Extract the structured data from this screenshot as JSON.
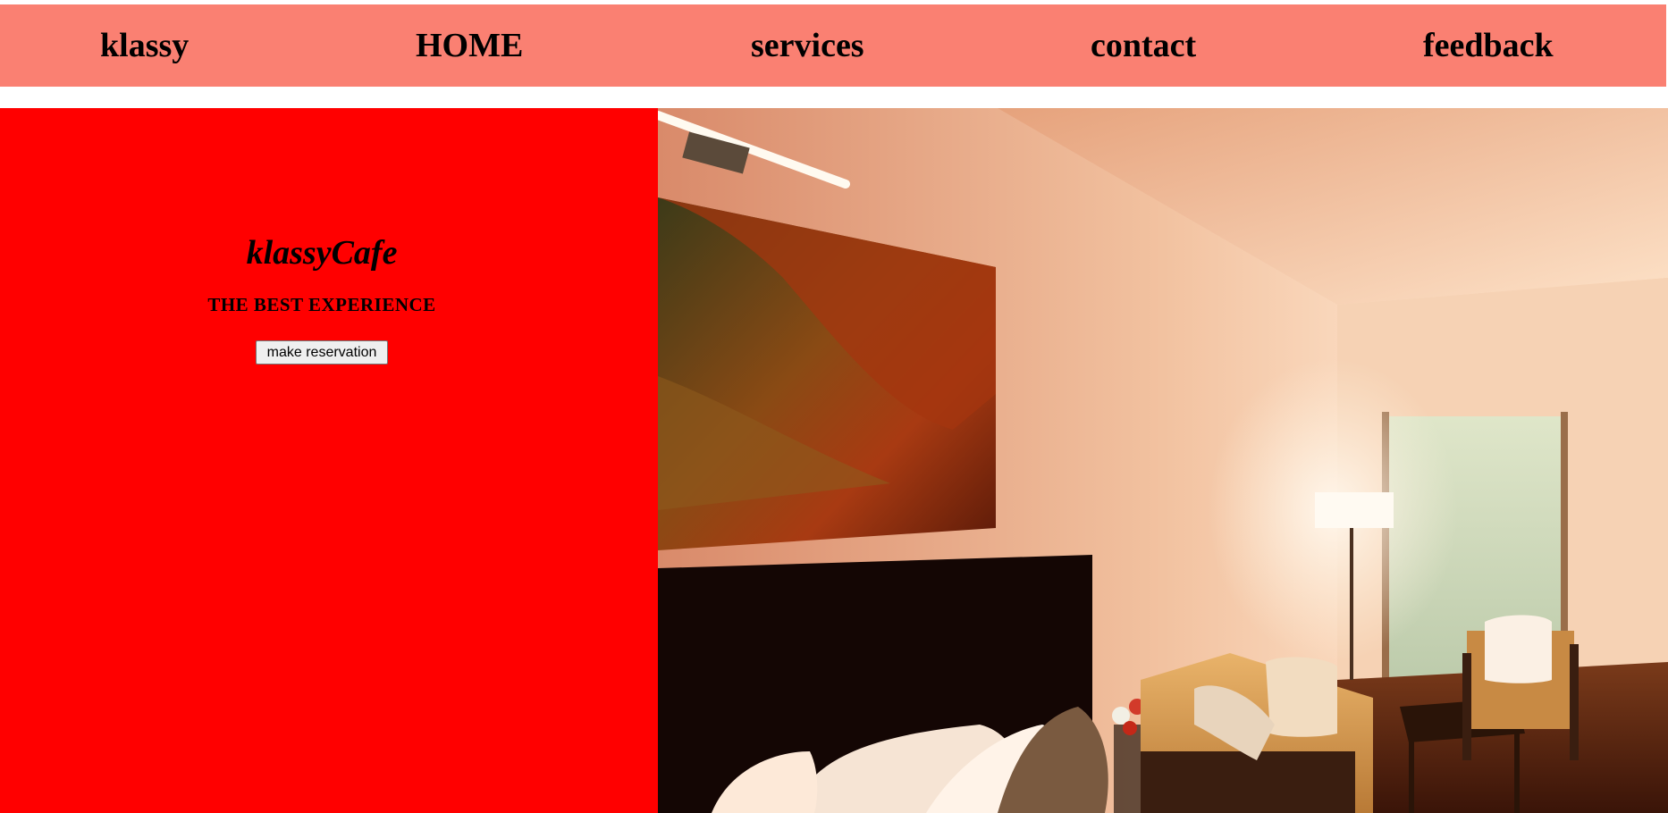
{
  "navbar": {
    "background_color": "#fa8072",
    "items": [
      {
        "label": "klassy"
      },
      {
        "label": "HOME"
      },
      {
        "label": "services"
      },
      {
        "label": "contact"
      },
      {
        "label": "feedback"
      }
    ]
  },
  "hero": {
    "background_color": "#ff0000",
    "title": "klassyCafe",
    "subtitle": "THE BEST EXPERIENCE",
    "button_label": "make reservation",
    "photo_icon": "hotel-room-photo"
  }
}
